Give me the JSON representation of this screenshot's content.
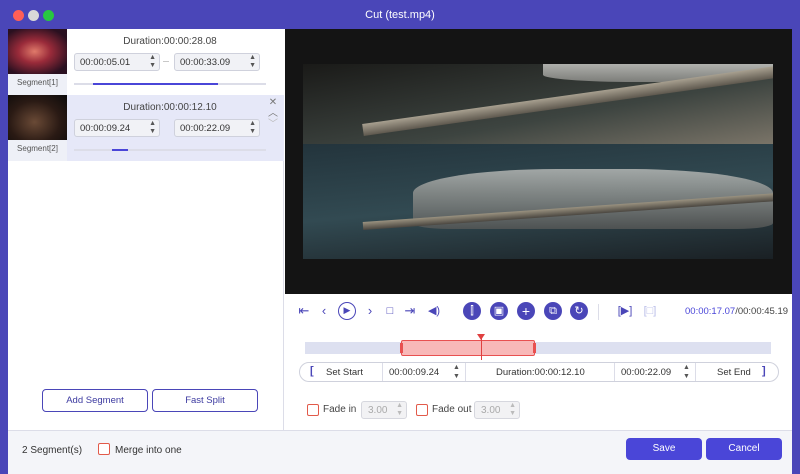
{
  "window": {
    "title": "Cut (test.mp4)"
  },
  "segments": [
    {
      "label": "Segment[1]",
      "duration": "Duration:00:00:28.08",
      "start": "00:00:05.01",
      "end": "00:00:33.09",
      "progress": 0.75
    },
    {
      "label": "Segment[2]",
      "duration": "Duration:00:00:12.10",
      "start": "00:00:09.24",
      "end": "00:00:22.09",
      "progress": 0.28
    }
  ],
  "left_buttons": {
    "add": "Add Segment",
    "split": "Fast Split"
  },
  "player": {
    "current_time": "00:00:17.07",
    "total_time": "/00:00:45.19"
  },
  "edit": {
    "set_start": "Set Start",
    "start_time": "00:00:09.24",
    "duration": "Duration:00:00:12.10",
    "end_time": "00:00:22.09",
    "set_end": "Set End",
    "left_bracket": "[",
    "right_bracket": "]"
  },
  "fade": {
    "in_label": "Fade in",
    "in_value": "3.00",
    "out_label": "Fade out",
    "out_value": "3.00"
  },
  "footer": {
    "count": "2 Segment(s)",
    "merge_label": "Merge into one",
    "save": "Save",
    "cancel": "Cancel"
  },
  "colors": {
    "accent": "#4a46d8",
    "chrome": "#4a46b8",
    "selection": "#f8b8b8",
    "checkbox": "#e25a4a"
  },
  "icons": {
    "controls": [
      "skip-start-icon",
      "prev-frame-icon",
      "play-icon",
      "next-frame-icon",
      "stop-icon",
      "skip-end-icon",
      "volume-icon",
      "split-icon",
      "crop-icon",
      "add-icon",
      "copy-icon",
      "reset-icon",
      "preview-icon",
      "fullscreen-icon"
    ]
  }
}
